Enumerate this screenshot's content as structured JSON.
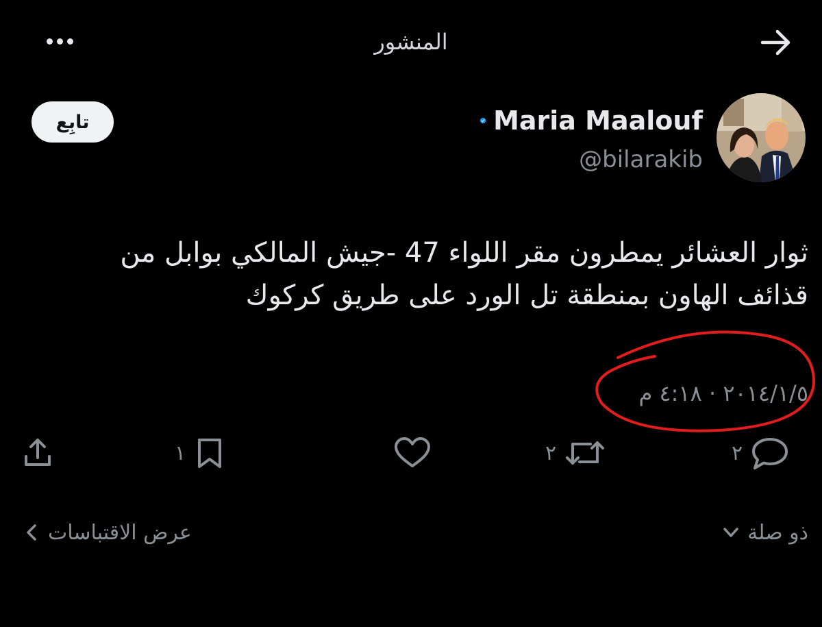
{
  "header": {
    "title": "المنشور",
    "more_icon": "more-horizontal-icon",
    "back_icon": "arrow-right-icon"
  },
  "author": {
    "name": "Maria Maalouf",
    "handle": "@bilarakib",
    "verified_icon": "verified-badge-icon",
    "verified_color": "#1d9bf0"
  },
  "follow_button": {
    "label": "تابِع"
  },
  "tweet": {
    "lines": [
      "ثوار العشائر يمطرون مقر اللواء 47 -جيش المالكي بوابل من",
      "قذائف الهاون بمنطقة تل الورد على طريق كركوك"
    ],
    "timestamp": "٢٠١٤/١/٥ · ٤:١٨ م"
  },
  "actions": {
    "reply_count": "٢",
    "retweet_count": "٢",
    "bookmark_count": "١",
    "like_icon": "heart-icon",
    "share_icon": "share-icon"
  },
  "bottom": {
    "view_quotes_label": "عرض الاقتباسات",
    "relevant_label": "ذو صلة"
  },
  "colors": {
    "background": "#000000",
    "text": "#e7e9ea",
    "muted": "#8b9096",
    "annotation_circle": "#e11d1d"
  }
}
